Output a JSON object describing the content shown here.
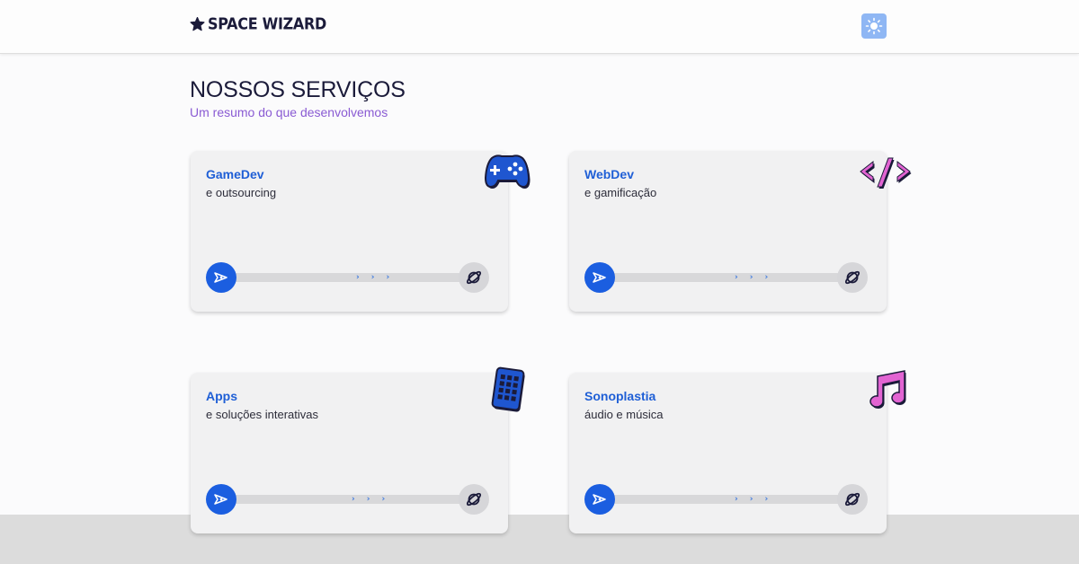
{
  "header": {
    "brand": "SPACE WIZARD",
    "logo_icon": "wizard-hat-icon",
    "theme_toggle_icon": "sun-icon"
  },
  "section": {
    "title": "NOSSOS SERVIÇOS",
    "subtitle": "Um resumo do que desenvolvemos"
  },
  "services": [
    {
      "title": "GameDev",
      "description": "e outsourcing",
      "icon": "gamepad-icon"
    },
    {
      "title": "WebDev",
      "description": "e gamificação",
      "icon": "code-icon"
    },
    {
      "title": "Apps",
      "description": "e soluções interativas",
      "icon": "smartphone-icon"
    },
    {
      "title": "Sonoplastia",
      "description": "áudio e música",
      "icon": "music-note-icon"
    }
  ],
  "progress": {
    "start_icon": "rocket-icon",
    "end_icon": "planet-icon",
    "arrow_glyph": "›"
  },
  "colors": {
    "accent_blue": "#1b5ee0",
    "title_dark": "#1b1b3a",
    "subtitle_purple": "#8a5bd3",
    "icon_pink": "#e264d2",
    "toggle_blue": "#8fb7f4"
  }
}
